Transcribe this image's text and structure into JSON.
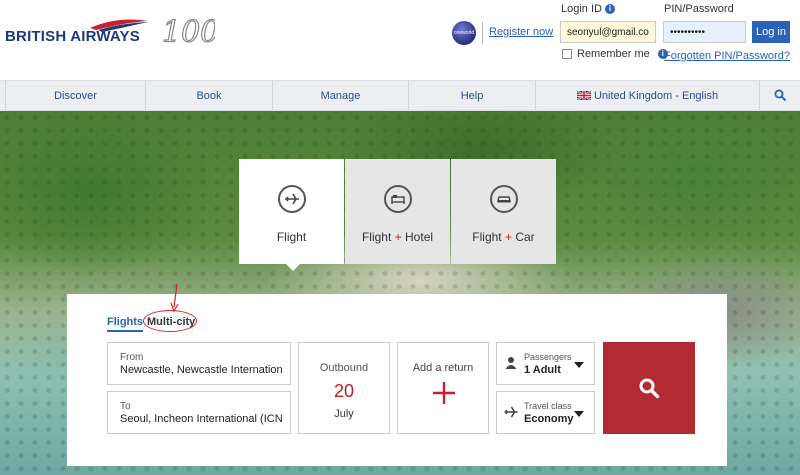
{
  "brand": {
    "name": "BRITISH AIRWAYS",
    "centenary_mark": "100",
    "oneworld_label": "oneworld",
    "accent_color": "#2a62b8",
    "cta_color": "#b22a33"
  },
  "header": {
    "register_label": "Register now",
    "login_id_label": "Login ID",
    "login_id_value": "seonyul@gmail.com",
    "pin_label": "PIN/Password",
    "pin_value": "••••••••••",
    "login_button": "Log in",
    "remember_me": "Remember me",
    "forgot_link": "Forgotten PIN/Password?",
    "info_icon": "i"
  },
  "nav": {
    "items": [
      {
        "label": "Discover"
      },
      {
        "label": "Book"
      },
      {
        "label": "Manage"
      },
      {
        "label": "Help"
      }
    ],
    "locale": "United Kingdom - English",
    "search_icon": "search-icon"
  },
  "product_tabs": [
    {
      "label": "Flight",
      "plus": "",
      "suffix": "",
      "icon": "plane-icon",
      "active": true
    },
    {
      "label": "Flight",
      "plus": "+",
      "suffix": "Hotel",
      "icon": "bed-icon",
      "active": false
    },
    {
      "label": "Flight",
      "plus": "+",
      "suffix": "Car",
      "icon": "car-icon",
      "active": false
    }
  ],
  "booking": {
    "trip_tabs": [
      {
        "label": "Flights",
        "active": true
      },
      {
        "label": "Multi-city",
        "active": false
      }
    ],
    "from_label": "From",
    "from_value": "Newcastle, Newcastle International",
    "to_label": "To",
    "to_value": "Seoul, Incheon International (ICN),",
    "outbound_label": "Outbound",
    "outbound_day": "20",
    "outbound_month": "July",
    "add_return_label": "Add a return",
    "passengers_label": "Passengers",
    "passengers_value": "1 Adult",
    "class_label": "Travel class",
    "class_value": "Economy"
  }
}
